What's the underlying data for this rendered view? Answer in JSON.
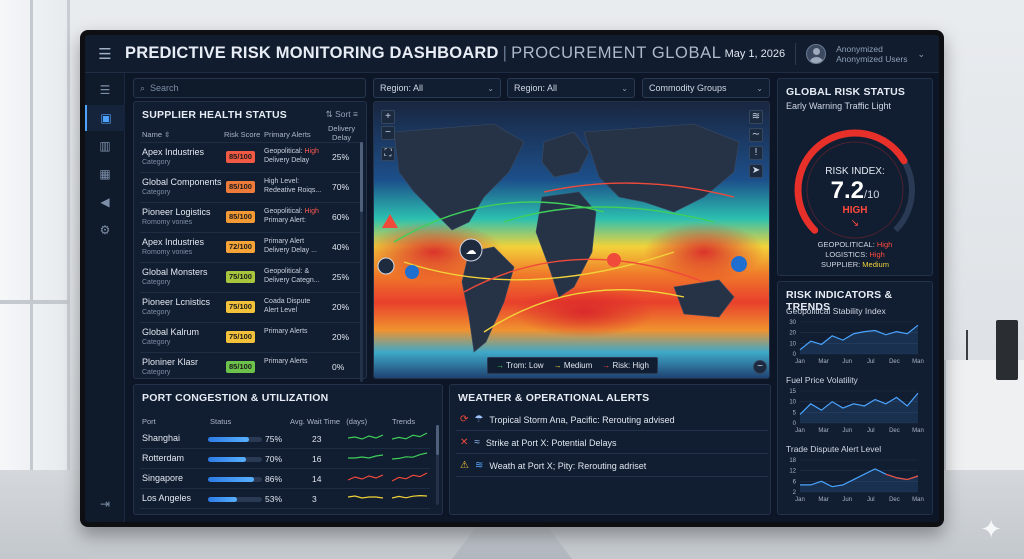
{
  "header": {
    "title": "PREDICTIVE RISK MONITORING DASHBOARD",
    "separator": "|",
    "subtitle": "PROCUREMENT GLOBAL",
    "date": "May 1, 2026",
    "user_line1": "Anonymized",
    "user_line2": "Anonymized Users"
  },
  "filters": {
    "search_placeholder": "Search",
    "region1": "Region: All",
    "region2": "Region: All",
    "commodity": "Commodity Groups"
  },
  "supplier": {
    "title": "SUPPLIER HEALTH STATUS",
    "sort_label": "Sort",
    "col_name": "Name",
    "col_score": "Risk Score",
    "col_alerts": "Primary Alerts",
    "col_delay_1": "Delivery",
    "col_delay_2": "Delay",
    "rows": [
      {
        "name": "Apex Industries",
        "cat": "Category",
        "score": "85/100",
        "color": "#f05a44",
        "a1": "Geopolitical: ",
        "a1hi": "High",
        "a2": "Delivery Delay",
        "delay": "25%"
      },
      {
        "name": "Global Components",
        "cat": "Category",
        "score": "85/100",
        "color": "#ef7b3a",
        "a1": "High Level:",
        "a1hi": "",
        "a2": "Redeative Roiqs...",
        "delay": "70%"
      },
      {
        "name": "Pioneer Logistics",
        "cat": "Romomy vonies",
        "score": "85/100",
        "color": "#f39a34",
        "a1": "Geopolitical: ",
        "a1hi": "High",
        "a2": "Primary Alert:",
        "delay": "60%"
      },
      {
        "name": "Apex Industries",
        "cat": "Romomy vonies",
        "score": "72/100",
        "color": "#f6a338",
        "a1": "Primary Alert",
        "a1hi": "",
        "a2": "Delivery Delay ...",
        "delay": "40%"
      },
      {
        "name": "Global Monsters",
        "cat": "Category",
        "score": "75/100",
        "color": "#a7c63d",
        "a1": "Geopolitical: &",
        "a1hi": "",
        "a2": "Delivery Categn...",
        "delay": "25%"
      },
      {
        "name": "Pioneer Lcnistics",
        "cat": "Category",
        "score": "75/100",
        "color": "#f3c23a",
        "a1": "Coada Dispute",
        "a1hi": "",
        "a2": "Alert Level",
        "delay": "20%"
      },
      {
        "name": "Global Kalrum",
        "cat": "Category",
        "score": "75/100",
        "color": "#f3c23a",
        "a1": "Primary Alerts",
        "a1hi": "",
        "a2": "",
        "delay": "20%"
      },
      {
        "name": "Ploniner Klasr",
        "cat": "Category",
        "score": "85/100",
        "color": "#6cc24a",
        "a1": "Primary Alerts",
        "a1hi": "",
        "a2": "",
        "delay": "0%"
      }
    ]
  },
  "map": {
    "legend_low": "Trom: Low",
    "legend_med": "Medium",
    "legend_high": "Risk: High",
    "low_color": "#3fcf5a",
    "med_color": "#f2d23a",
    "high_color": "#f04a3a"
  },
  "global_risk": {
    "title": "GLOBAL RISK STATUS",
    "subtitle": "Early Warning Traffic Light",
    "index_label": "RISK INDEX:",
    "value": "7.2",
    "scale": "/10",
    "level": "HIGH",
    "index_fraction": 0.72,
    "geo_label": "GEOPOLITICAL:",
    "geo_val": "High",
    "log_label": "LOGISTICS:",
    "log_val": "High",
    "sup_label": "SUPPLIER:",
    "sup_val": "Medium"
  },
  "ports": {
    "title": "PORT CONGESTION & UTILIZATION",
    "col_port": "Port",
    "col_status": "Status",
    "col_wait": "Avg. Wait Time",
    "col_days": "(days)",
    "col_trends": "Trends",
    "rows": [
      {
        "name": "Shanghai",
        "pct": "75%",
        "value": 0.75,
        "wait": "23",
        "trend_color": "#3fcf5a"
      },
      {
        "name": "Rotterdam",
        "pct": "70%",
        "value": 0.7,
        "wait": "16",
        "trend_color": "#3fcf5a"
      },
      {
        "name": "Singapore",
        "pct": "86%",
        "value": 0.86,
        "wait": "14",
        "trend_color": "#f04a3a"
      },
      {
        "name": "Los Angeles",
        "pct": "53%",
        "value": 0.53,
        "wait": "3",
        "trend_color": "#f2d23a"
      }
    ]
  },
  "weather": {
    "title": "WEATHER & OPERATIONAL ALERTS",
    "alerts": [
      {
        "text": "Tropical Storm Ana, Pacific: Rerouting advised"
      },
      {
        "text": "Strike at Port X: Potential Delays"
      },
      {
        "text": "Weath at Port X; Pity: Rerouting adriset"
      }
    ]
  },
  "indicators": {
    "title": "RISK INDICATORS & TRENDS",
    "months": [
      "Jan",
      "Mar",
      "Jun",
      "Jul",
      "Dec",
      "Man"
    ],
    "charts": [
      {
        "label": "Geopolitical Stability Index",
        "yticks": [
          "30",
          "20",
          "10",
          "0"
        ],
        "ymax": 30,
        "values": [
          4,
          12,
          9,
          17,
          13,
          19,
          21,
          22,
          18,
          21,
          19,
          27
        ]
      },
      {
        "label": "Fuel Price Volatility",
        "yticks": [
          "15",
          "10",
          "5",
          "0"
        ],
        "ymax": 15,
        "values": [
          4,
          9,
          6,
          10,
          7,
          9,
          8,
          11,
          9,
          12,
          8,
          14
        ]
      },
      {
        "label": "Trade Dispute Alert Level",
        "yticks": [
          "18",
          "12",
          "6",
          "2"
        ],
        "ymax": 18,
        "values": [
          4,
          4,
          6,
          3,
          4,
          7,
          10,
          13,
          10,
          8,
          7,
          9
        ]
      }
    ]
  }
}
